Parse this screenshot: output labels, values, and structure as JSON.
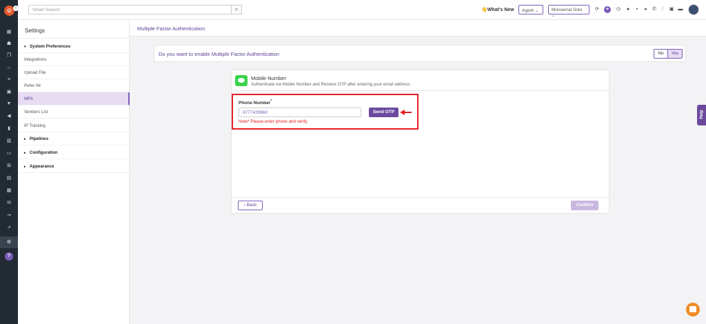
{
  "search": {
    "placeholder": "Smart Search",
    "button_icon": "search-icon"
  },
  "topbar": {
    "whats_new": "👋What's New",
    "agent_select": "Agent",
    "user_select": "Monserrat Soto"
  },
  "sidebar": {
    "title": "Settings",
    "items": [
      {
        "label": "System Preferences",
        "type": "section",
        "caret": "▾"
      },
      {
        "label": "Integrations"
      },
      {
        "label": "Upload File"
      },
      {
        "label": "Refer IM"
      },
      {
        "label": "MFA",
        "active": true
      },
      {
        "label": "Senders List"
      },
      {
        "label": "IP Tracking"
      },
      {
        "label": "Pipelines",
        "type": "section",
        "caret": "▸"
      },
      {
        "label": "Configuration",
        "type": "section",
        "caret": "▸"
      },
      {
        "label": "Appearance",
        "type": "section",
        "caret": "▸"
      }
    ]
  },
  "main": {
    "header_title": "Multiple Factor Authentication",
    "question": "Do you want to enable Multiple Factor Authentication",
    "no_label": "No",
    "yes_label": "Yes",
    "selected": "Yes",
    "card": {
      "title": "Mobile Number",
      "description": "Authenticate via Mobile Number and Receive OTP after entering your email address.",
      "phone_label": "Phone Number",
      "required_mark": "*",
      "phone_value": "9777429960",
      "send_otp": "Send OTP",
      "note": "Note* Please enter phone and verify.",
      "back": "Back",
      "back_prefix": "‹",
      "confirm": "Confirm"
    }
  },
  "help_tab": "Help",
  "colors": {
    "accent": "#7b5cb8",
    "accent_dark": "#6b4a9e",
    "highlight_border": "#e51c24",
    "rail": "#222a33",
    "logo": "#e2592d",
    "chat_fab": "#f08b22"
  }
}
